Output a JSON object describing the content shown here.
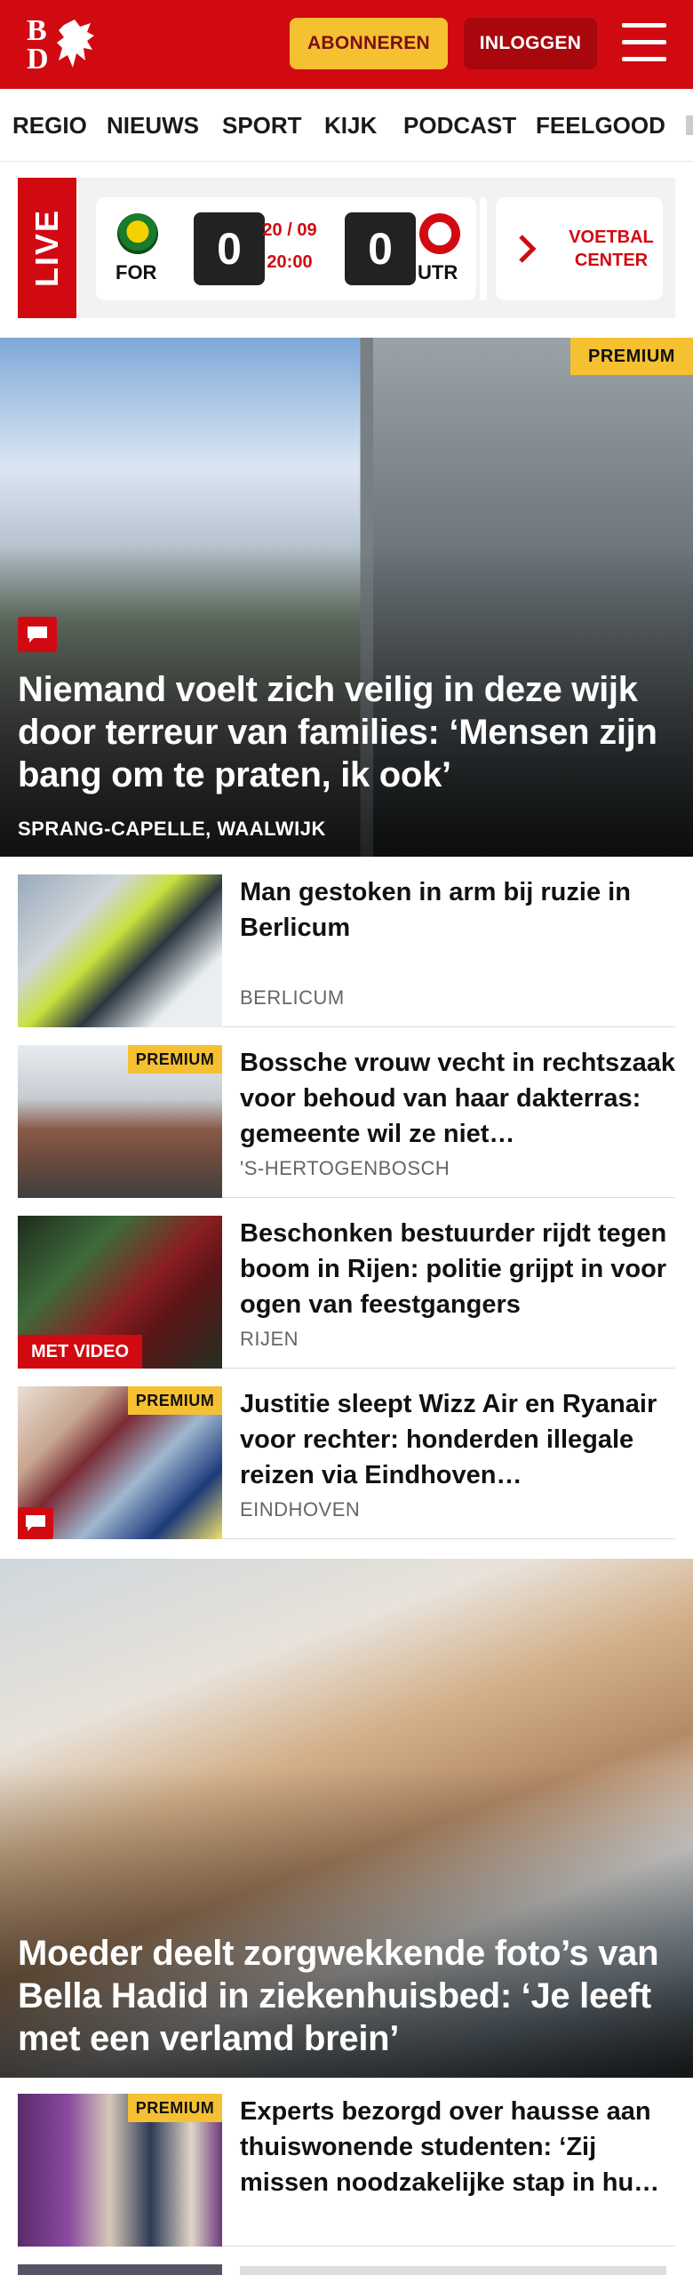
{
  "header": {
    "logo_letters": [
      "B",
      "D"
    ],
    "subscribe_label": "ABONNEREN",
    "login_label": "INLOGGEN",
    "brand_color": "#d10a11",
    "accent_color": "#f6c033"
  },
  "nav": {
    "items": [
      "REGIO",
      "NIEUWS",
      "SPORT",
      "KIJK",
      "PODCAST",
      "FEELGOOD"
    ]
  },
  "live": {
    "label": "LIVE",
    "match": {
      "home_code": "FOR",
      "away_code": "UTR",
      "home_score": "0",
      "away_score": "0",
      "date": "20 / 09",
      "time": "20:00"
    },
    "voetbal_center_line1": "VOETBAL",
    "voetbal_center_line2": "CENTER"
  },
  "hero": {
    "premium_label": "PREMIUM",
    "title": "Niemand voelt zich veilig in deze wijk door terreur van families: ‘Mensen zijn bang om te praten, ik ook’",
    "location": "SPRANG-CAPELLE, WAALWIJK"
  },
  "articles": [
    {
      "title": "Man gestoken in arm bij ruzie in Berlicum",
      "location": "BERLICUM"
    },
    {
      "title": "Bossche vrouw vecht in rechtszaak voor behoud van haar dakterras: gemeente wil ze niet…",
      "location": "'S-HERTOGENBOSCH",
      "premium_label": "PREMIUM"
    },
    {
      "title": "Beschonken bestuurder rijdt tegen boom in Rijen: politie grijpt in voor ogen van feestgangers",
      "location": "RIJEN",
      "video_label": "MET VIDEO"
    },
    {
      "title": "Justitie sleept Wizz Air en Ryanair voor rechter: honderden illegale reizen via Eindhoven…",
      "location": "EINDHOVEN",
      "premium_label": "PREMIUM"
    }
  ],
  "hero2": {
    "title": "Moeder deelt zorgwekkende foto’s van Bella Hadid in ziekenhuisbed: ‘Je leeft met een verlamd brein’"
  },
  "articles2": [
    {
      "title": "Experts bezorgd over hausse aan thuiswonende studenten: ‘Zij missen noodzakelijke stap in hu…",
      "premium_label": "PREMIUM"
    }
  ]
}
